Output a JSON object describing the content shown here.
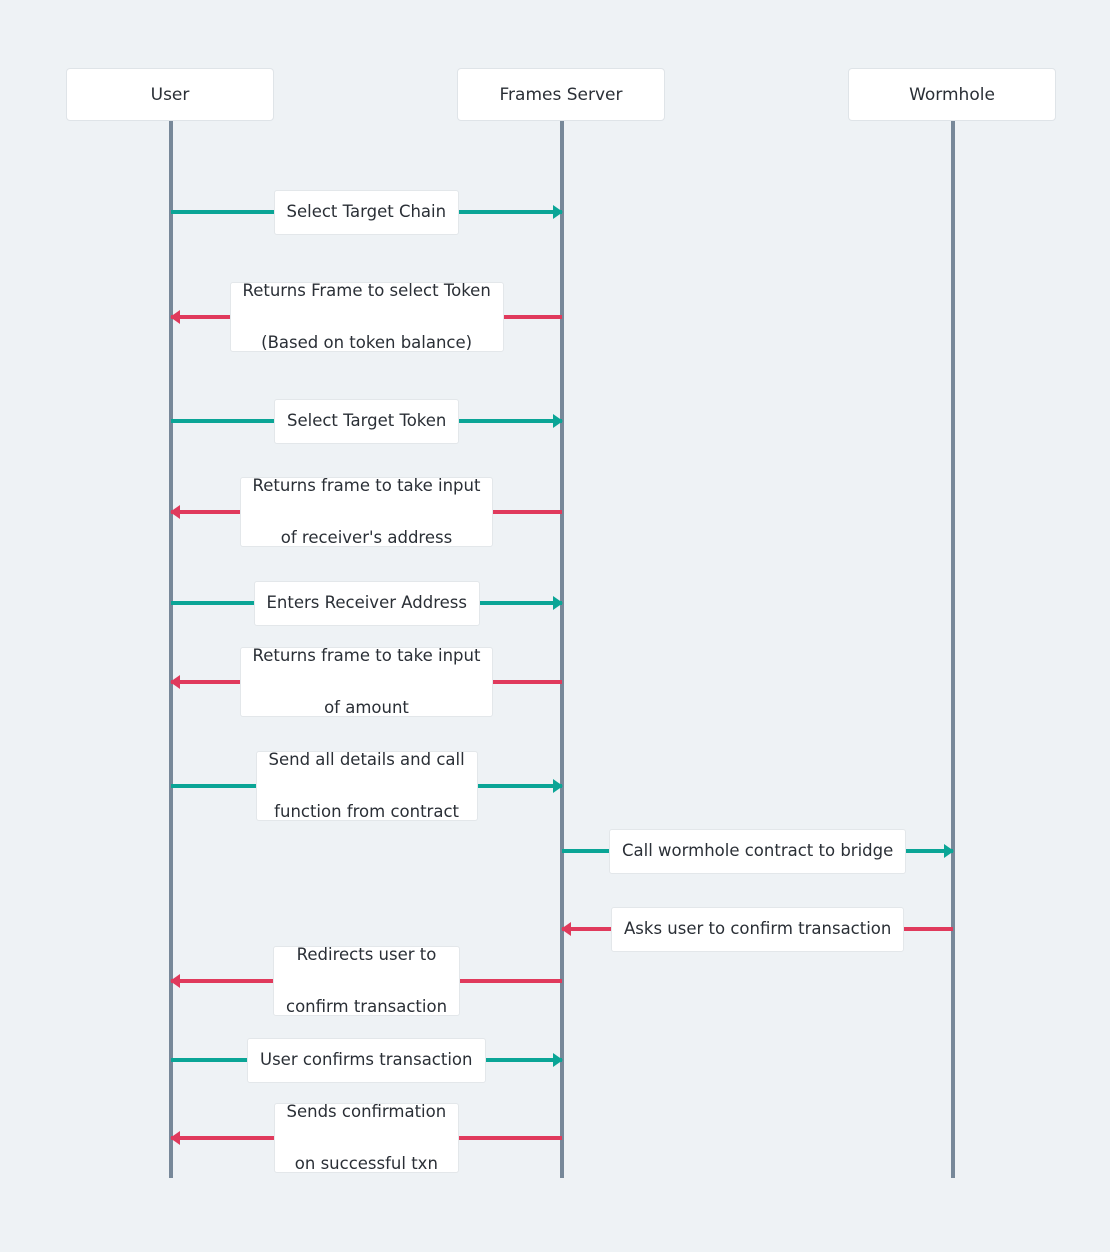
{
  "actors": [
    {
      "name": "User"
    },
    {
      "name": "Frames Server"
    },
    {
      "name": "Wormhole"
    }
  ],
  "colors": {
    "request": "#0aa596",
    "response": "#e03a5c",
    "lifeline": "#778899",
    "background": "#eef2f5"
  },
  "messages": [
    {
      "from": "User",
      "to": "Frames Server",
      "type": "request",
      "text": "Select Target Chain"
    },
    {
      "from": "Frames Server",
      "to": "User",
      "type": "response",
      "text": "Returns Frame to select Token\n(Based on token balance)"
    },
    {
      "from": "User",
      "to": "Frames Server",
      "type": "request",
      "text": "Select Target Token"
    },
    {
      "from": "Frames Server",
      "to": "User",
      "type": "response",
      "text": "Returns frame to take input\nof receiver's address"
    },
    {
      "from": "User",
      "to": "Frames Server",
      "type": "request",
      "text": "Enters Receiver Address"
    },
    {
      "from": "Frames Server",
      "to": "User",
      "type": "response",
      "text": "Returns frame to take input\nof amount"
    },
    {
      "from": "User",
      "to": "Frames Server",
      "type": "request",
      "text": "Send all details and call\nfunction from contract"
    },
    {
      "from": "Frames Server",
      "to": "Wormhole",
      "type": "request",
      "text": "Call wormhole contract to bridge"
    },
    {
      "from": "Wormhole",
      "to": "Frames Server",
      "type": "response",
      "text": "Asks user to confirm transaction"
    },
    {
      "from": "Frames Server",
      "to": "User",
      "type": "response",
      "text": "Redirects user to\nconfirm transaction"
    },
    {
      "from": "User",
      "to": "Frames Server",
      "type": "request",
      "text": "User confirms transaction"
    },
    {
      "from": "Frames Server",
      "to": "User",
      "type": "response",
      "text": "Sends confirmation\non successful txn"
    }
  ]
}
